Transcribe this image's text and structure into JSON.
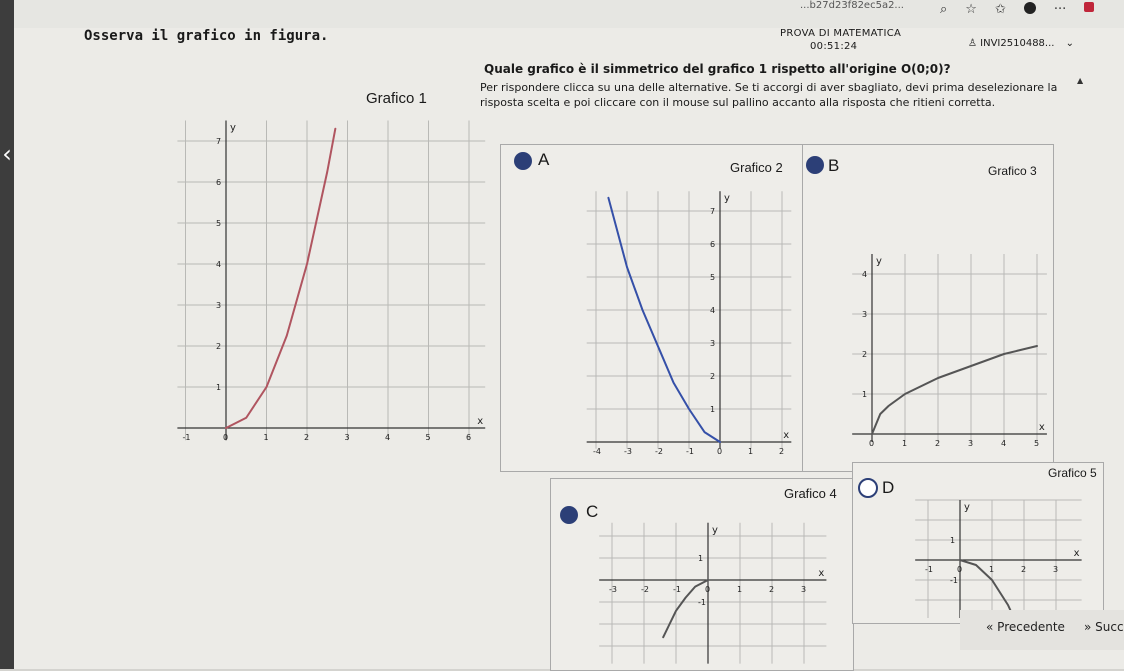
{
  "browser": {
    "url": "...b27d23f82ec5a2...",
    "icons": [
      "zoom-icon",
      "star-icon",
      "favorites-icon",
      "profile-icon",
      "more-icon",
      "extension-icon"
    ]
  },
  "header": {
    "test_name": "PROVA DI MATEMATICA",
    "timer": "00:51:24",
    "user_id": "INVI2510488..."
  },
  "instruction": "Osserva il grafico in figura.",
  "question": "Quale grafico è il simmetrico del grafico 1 rispetto all'origine O(0;0)?",
  "help_text": "Per rispondere clicca su una delle alternative. Se ti accorgi di aver sbagliato, devi prima deselezionare la risposta scelta e poi cliccare con il mouse sul pallino accanto alla risposta che ritieni corretta.",
  "main_graph": {
    "title": "Grafico 1"
  },
  "options": [
    {
      "letter": "A",
      "graph_title": "Grafico 2"
    },
    {
      "letter": "B",
      "graph_title": "Grafico 3"
    },
    {
      "letter": "C",
      "graph_title": "Grafico 4"
    },
    {
      "letter": "D",
      "graph_title": "Grafico 5"
    }
  ],
  "nav": {
    "prev": "Precedente",
    "next": "Succ"
  },
  "colors": {
    "accent": "#2c3f77",
    "curve_red": "#b05560",
    "curve_blue": "#3550a8",
    "curve_gray": "#555555"
  },
  "chart_data": [
    {
      "type": "line",
      "title": "Grafico 1",
      "x_ticks": [
        "-1",
        "0",
        "1",
        "2",
        "3",
        "4",
        "5",
        "6"
      ],
      "y_ticks": [
        "0",
        "1",
        "2",
        "3",
        "4",
        "5",
        "6",
        "7"
      ],
      "xlabel": "x",
      "ylabel": "y",
      "series": [
        {
          "x": [
            0,
            0.5,
            1,
            1.5,
            2,
            2.5,
            2.7
          ],
          "y": [
            0,
            0.25,
            1,
            2.25,
            4,
            6.25,
            7.3
          ]
        }
      ]
    },
    {
      "type": "line",
      "title": "Grafico 2",
      "x_ticks": [
        "-4",
        "-3",
        "-2",
        "-1",
        "0",
        "1",
        "2"
      ],
      "y_ticks": [
        "1",
        "2",
        "3",
        "4",
        "5",
        "6",
        "7"
      ],
      "xlabel": "x",
      "ylabel": "y",
      "series": [
        {
          "x": [
            -3.6,
            -3,
            -2.5,
            -2,
            -1.5,
            -1,
            -0.5,
            0
          ],
          "y": [
            7.4,
            5.3,
            4.0,
            2.9,
            1.8,
            1.0,
            0.3,
            0
          ]
        }
      ]
    },
    {
      "type": "line",
      "title": "Grafico 3",
      "x_ticks": [
        "0",
        "1",
        "2",
        "3",
        "4",
        "5"
      ],
      "y_ticks": [
        "1",
        "2",
        "3",
        "4"
      ],
      "xlabel": "x",
      "ylabel": "y",
      "series": [
        {
          "x": [
            0,
            0.25,
            0.5,
            1,
            2,
            3,
            4,
            5
          ],
          "y": [
            0,
            0.5,
            0.7,
            1.0,
            1.4,
            1.7,
            2.0,
            2.2
          ]
        }
      ]
    },
    {
      "type": "line",
      "title": "Grafico 4",
      "x_ticks": [
        "-3",
        "-2",
        "-1",
        "0",
        "1",
        "2",
        "3"
      ],
      "y_ticks": [
        "1",
        "-1"
      ],
      "xlabel": "x",
      "ylabel": "y",
      "series": [
        {
          "x": [
            -1.4,
            -1.2,
            -1,
            -0.7,
            -0.4,
            0
          ],
          "y": [
            -2.6,
            -2.0,
            -1.4,
            -0.8,
            -0.3,
            0
          ]
        }
      ]
    },
    {
      "type": "line",
      "title": "Grafico 5",
      "x_ticks": [
        "-1",
        "0",
        "1",
        "2",
        "3"
      ],
      "y_ticks": [
        "1",
        "-1"
      ],
      "xlabel": "x",
      "ylabel": "y",
      "series": [
        {
          "x": [
            0,
            0.5,
            1,
            1.5,
            2
          ],
          "y": [
            0,
            -0.25,
            -1,
            -2.25,
            -4
          ]
        }
      ]
    }
  ]
}
